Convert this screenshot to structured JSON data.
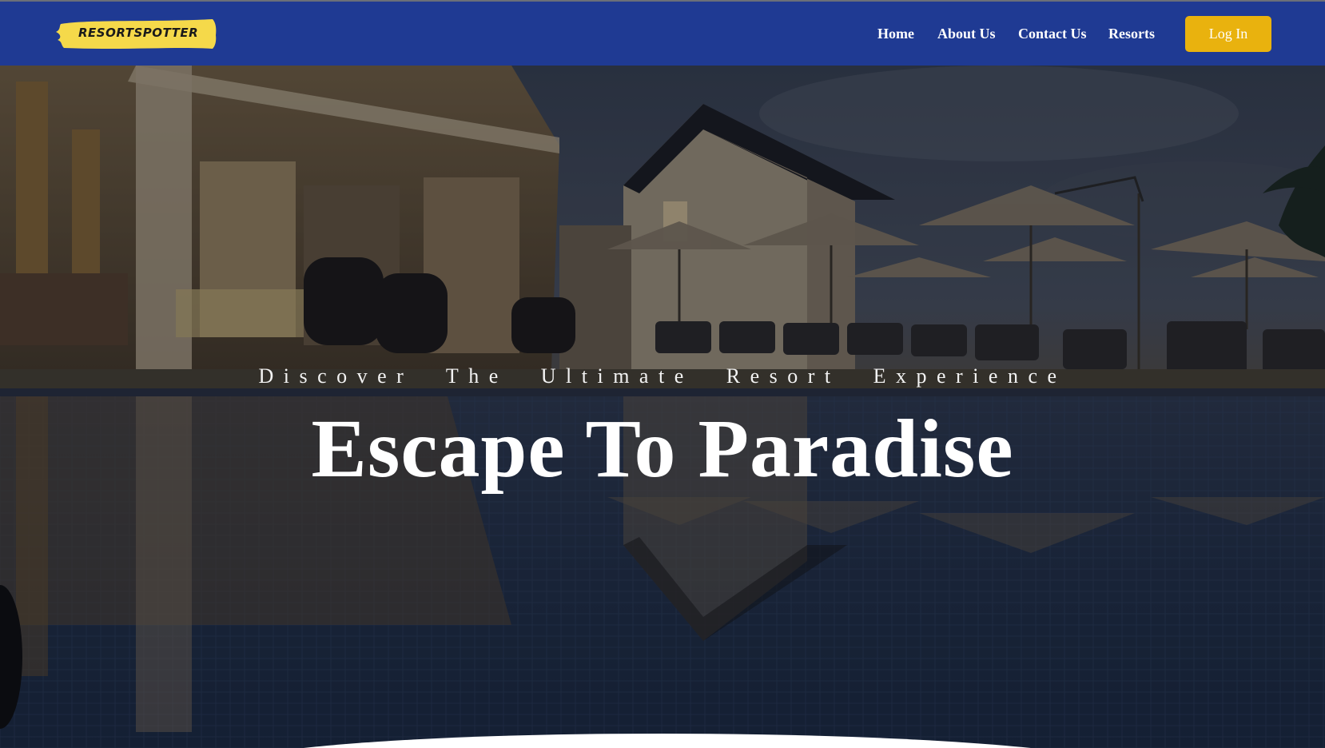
{
  "brand": {
    "logo_text": "RESORTSPOTTER",
    "logo_color": "#f5d94a"
  },
  "nav": {
    "items": [
      {
        "label": "Home"
      },
      {
        "label": "About Us"
      },
      {
        "label": "Contact Us"
      },
      {
        "label": "Resorts"
      }
    ],
    "login_label": "Log In",
    "bar_color": "#1f3a93",
    "login_color": "#e9b20e"
  },
  "hero": {
    "subtitle": "Discover The Ultimate Resort Experience",
    "title": "Escape To Paradise",
    "background": "resort-pool-night-photo"
  }
}
